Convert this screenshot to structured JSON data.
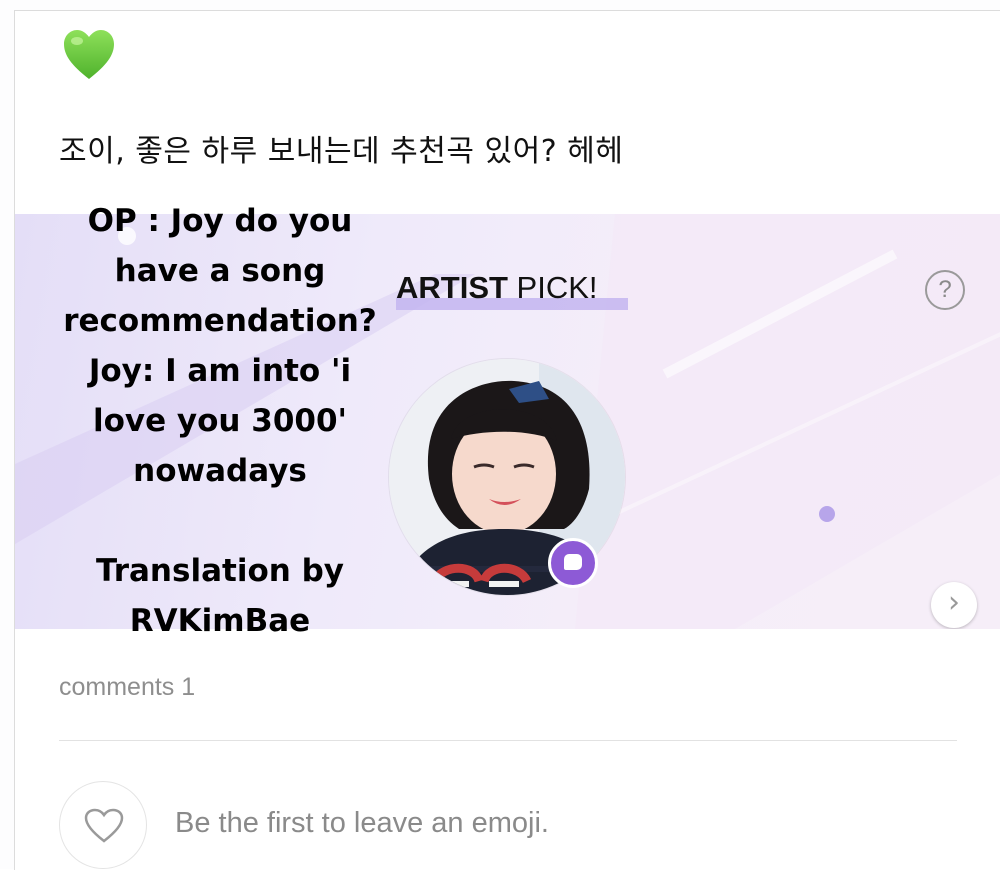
{
  "post": {
    "emoji_icon": "green-heart-icon",
    "text": "조이, 좋은 하루 보내는데 추천곡 있어? 헤헤"
  },
  "banner": {
    "artist_pick_strong": "ARTIST",
    "artist_pick_rest": " PICK!",
    "help_label": "?",
    "next_label": "›",
    "badge_icon": "chat-bubble-icon",
    "accent": "#8d5ad6"
  },
  "overlay": {
    "lines": [
      "OP : Joy do you",
      "have a song",
      "recommendation?",
      "Joy: I am into 'i",
      "love you 3000'",
      "nowadays"
    ],
    "credit_lines": [
      "Translation by",
      "RVKimBae"
    ]
  },
  "comments": {
    "label": "comments 1",
    "emoji_prompt": "Be the first to leave an emoji."
  }
}
